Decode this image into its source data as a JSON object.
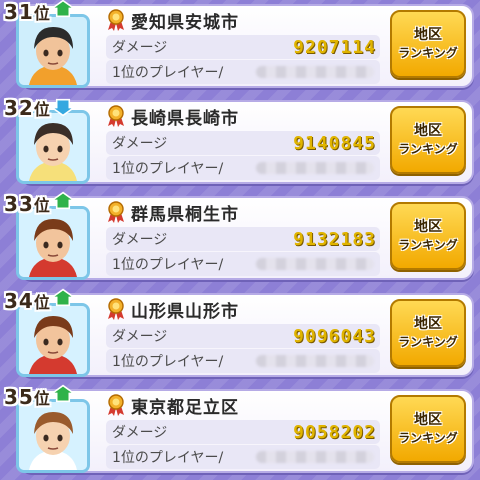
{
  "rank_suffix": "位",
  "damage_label": "ダメージ",
  "top_player_label": "1位のプレイヤー/",
  "button": {
    "line1": "地区",
    "line2": "ランキング"
  },
  "colors": {
    "up": "#2fb24a",
    "down": "#35a8e0",
    "value": "#e0b400",
    "button": "#f6c21a"
  },
  "entries": [
    {
      "rank": "31",
      "trend": "up",
      "city": "愛知県安城市",
      "damage": "9207114",
      "avatar": "dark-hair-man"
    },
    {
      "rank": "32",
      "trend": "down",
      "city": "長崎県長崎市",
      "damage": "9140845",
      "avatar": "boy-yellow-shirt"
    },
    {
      "rank": "33",
      "trend": "up",
      "city": "群馬県桐生市",
      "damage": "9132183",
      "avatar": "boy-red-jacket"
    },
    {
      "rank": "34",
      "trend": "up",
      "city": "山形県山形市",
      "damage": "9096043",
      "avatar": "boy-red-jacket"
    },
    {
      "rank": "35",
      "trend": "up",
      "city": "東京都足立区",
      "damage": "9058202",
      "avatar": "girl-brown-hair"
    }
  ]
}
